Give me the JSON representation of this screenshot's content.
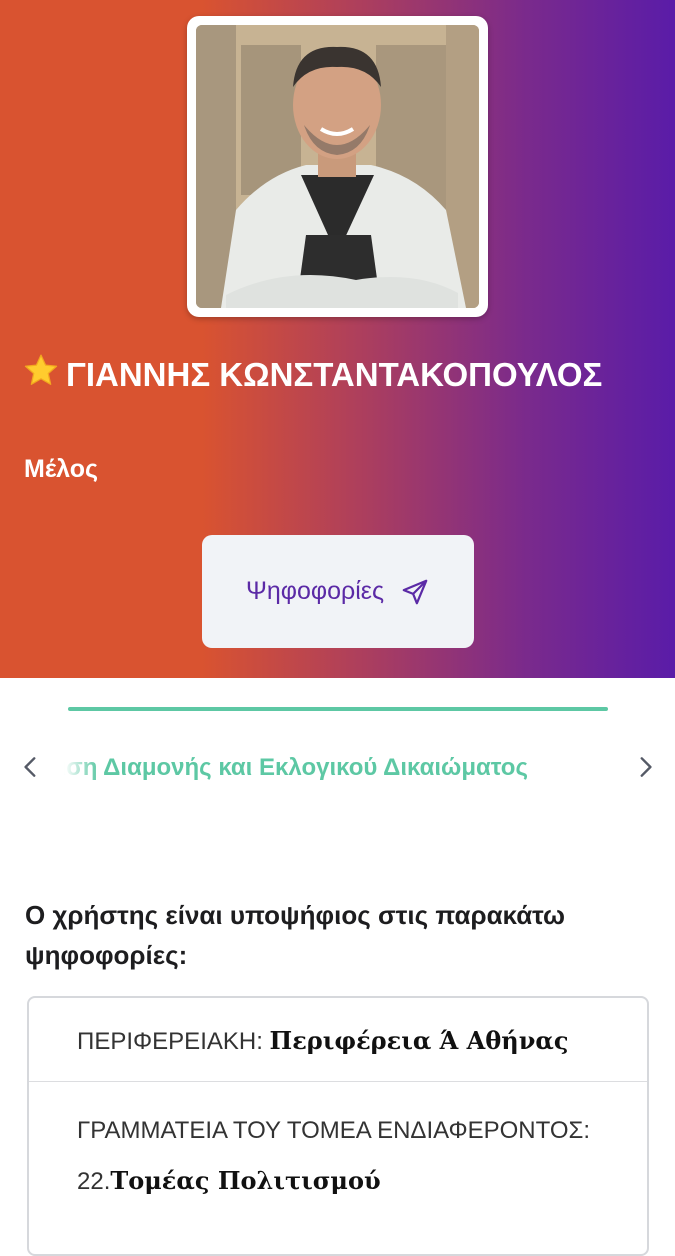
{
  "profile": {
    "name": "ΓΙΑΝΝΗΣ ΚΩΝΣΤΑΝΤΑΚΟΠΟΥΛΟΣ",
    "role": "Μέλος",
    "vote_button_label": "Ψηφοφορίες"
  },
  "tabs": {
    "visible_label": "Ρύθμιση Διαμονής και Εκλογικού Δικαιώματος"
  },
  "candidate_section": {
    "heading": "Ο χρήστης είναι υποψήφιος στις παρακάτω ψηφοφορίες:",
    "items": [
      {
        "prefix": "ΠΕΡΙΦΕΡΕΙΑΚΗ: ",
        "value": "Περιφέρεια Ά Αθήνας"
      },
      {
        "prefix": "ΓΡΑΜΜΑΤΕΙΑ ΤΟΥ ΤΟΜΕΑ ΕΝΔΙΑΦΕΡΟΝΤΟΣ: 22.",
        "value": "Τομέας Πολιτισμού"
      }
    ]
  },
  "colors": {
    "gradient_start": "#d95330",
    "gradient_end": "#5a1ca8",
    "accent_green": "#5dc8a4",
    "button_text": "#5b2aa6"
  },
  "icons": [
    "star-icon",
    "send-icon",
    "chevron-left-icon",
    "chevron-right-icon"
  ]
}
